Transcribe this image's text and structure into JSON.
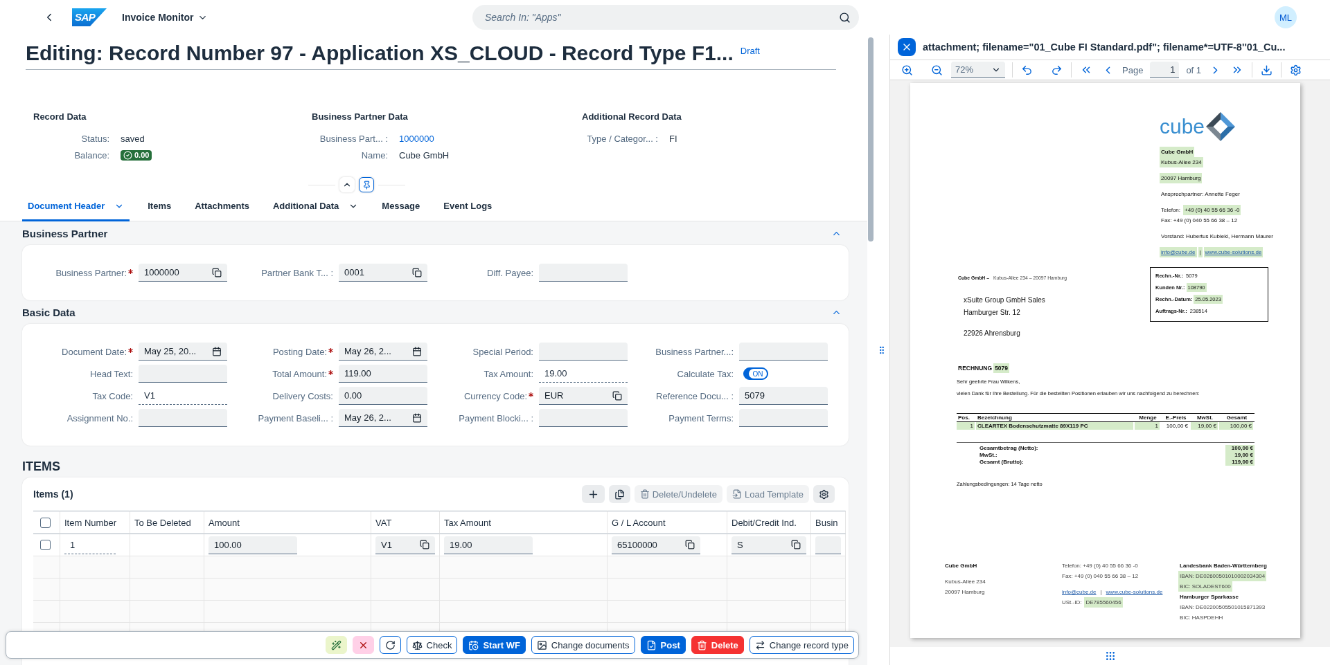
{
  "shell": {
    "logo_text": "SAP",
    "app_title": "Invoice Monitor",
    "search_placeholder": "Search In: \"Apps\"",
    "user_initials": "ML"
  },
  "header": {
    "title": "Editing: Record Number 97 - Application XS_CLOUD - Record Type F1...",
    "status": "Draft",
    "groups": [
      {
        "title": "Record Data",
        "fields": [
          {
            "label": "Status:",
            "value": "saved",
            "kind": "text"
          },
          {
            "label": "Balance:",
            "value": "0.00",
            "kind": "badge"
          }
        ]
      },
      {
        "title": "Business Partner Data",
        "fields": [
          {
            "label": "Business Part... :",
            "value": "1000000",
            "kind": "link"
          },
          {
            "label": "Name:",
            "value": "Cube GmbH",
            "kind": "text"
          }
        ]
      },
      {
        "title": "Additional Record Data",
        "fields": [
          {
            "label": "Type / Categor... :",
            "value": "FI",
            "kind": "text"
          }
        ]
      }
    ]
  },
  "tabs": [
    {
      "label": "Document Header",
      "selected": true,
      "menu": true
    },
    {
      "label": "Items",
      "selected": false,
      "menu": false
    },
    {
      "label": "Attachments",
      "selected": false,
      "menu": false
    },
    {
      "label": "Additional Data",
      "selected": false,
      "menu": true
    },
    {
      "label": "Message",
      "selected": false,
      "menu": false
    },
    {
      "label": "Event Logs",
      "selected": false,
      "menu": false
    }
  ],
  "sections": [
    {
      "title": "Business Partner",
      "expanded": true,
      "fields": [
        {
          "label": "Business Partner:",
          "required": true,
          "kind": "valuehelp",
          "value": "1000000"
        },
        {
          "label": "Partner Bank T... :",
          "required": false,
          "kind": "valuehelp",
          "value": "0001"
        },
        {
          "label": "Diff. Payee:",
          "required": false,
          "kind": "input"
        }
      ]
    },
    {
      "title": "Basic Data",
      "expanded": true,
      "fields": [
        {
          "label": "Document Date:",
          "required": true,
          "kind": "date",
          "value": "May 25, 20..."
        },
        {
          "label": "Posting Date:",
          "required": true,
          "kind": "date",
          "value": "May 26, 2..."
        },
        {
          "label": "Special Period:",
          "required": false,
          "kind": "input"
        },
        {
          "label": "Business Partner...:",
          "required": false,
          "kind": "input"
        },
        {
          "label": "Head Text:",
          "required": false,
          "kind": "input"
        },
        {
          "label": "Total Amount:",
          "required": true,
          "kind": "input",
          "value": "119.00"
        },
        {
          "label": "Tax Amount:",
          "required": false,
          "kind": "text",
          "value": "19.00"
        },
        {
          "label": "Calculate Tax:",
          "required": false,
          "kind": "switch",
          "on": true,
          "value": "ON"
        },
        {
          "label": "Tax Code:",
          "required": false,
          "kind": "text",
          "value": "V1"
        },
        {
          "label": "Delivery Costs:",
          "required": false,
          "kind": "input",
          "value": "0.00"
        },
        {
          "label": "Currency Code:",
          "required": true,
          "kind": "valuehelp",
          "value": "EUR"
        },
        {
          "label": "Reference Docu... :",
          "required": false,
          "kind": "input",
          "value": "5079"
        },
        {
          "label": "Assignment No.:",
          "required": false,
          "kind": "input"
        },
        {
          "label": "Payment Baseli... :",
          "required": false,
          "kind": "date",
          "value": "May 26, 2..."
        },
        {
          "label": "Payment Blocki... :",
          "required": false,
          "kind": "input"
        },
        {
          "label": "Payment Terms:",
          "required": false,
          "kind": "input"
        }
      ]
    }
  ],
  "items": {
    "title": "ITEMS",
    "table_title": "Items (1)",
    "toolbar": [
      {
        "kind": "add",
        "disabled": false
      },
      {
        "kind": "copy",
        "disabled": false
      },
      {
        "kind": "delete",
        "label": "Delete/Undelete",
        "disabled": true
      },
      {
        "kind": "template",
        "label": "Load Template",
        "disabled": true
      },
      {
        "kind": "settings",
        "disabled": false
      }
    ],
    "select_all_checked": false,
    "columns": [
      "Item Number",
      "To Be Deleted",
      "Amount",
      "VAT",
      "Tax Amount",
      "G / L Account",
      "Debit/Credit Ind.",
      "Busin"
    ],
    "rows": [
      {
        "checked": false,
        "cells": [
          {
            "kind": "text",
            "value": "1"
          },
          {
            "kind": "empty"
          },
          {
            "kind": "input",
            "value": "100.00"
          },
          {
            "kind": "valuehelp",
            "value": "V1"
          },
          {
            "kind": "input",
            "value": "19.00"
          },
          {
            "kind": "valuehelp",
            "value": "65100000"
          },
          {
            "kind": "valuehelp",
            "value": "S"
          },
          {
            "kind": "input"
          }
        ]
      }
    ]
  },
  "footer_actions": [
    {
      "kind": "wand"
    },
    {
      "kind": "cancel"
    },
    {
      "kind": "refresh"
    },
    {
      "kind": "check",
      "label": "Check"
    },
    {
      "kind": "workflow",
      "label": "Start WF"
    },
    {
      "kind": "documents",
      "label": "Change documents"
    },
    {
      "kind": "post",
      "label": "Post"
    },
    {
      "kind": "delete",
      "label": "Delete"
    },
    {
      "kind": "change",
      "label": "Change record type"
    }
  ],
  "pdf_viewer": {
    "title": "attachment; filename=\"01_Cube FI Standard.pdf\"; filename*=UTF-8''01_Cu...",
    "zoom": "72%",
    "page_label": "Page",
    "page": "1",
    "page_count": "of 1",
    "document": {
      "logo_text": "cube",
      "sender": [
        {
          "lines": [
            {
              "segments": [
                {
                  "text": "Cube GmbH",
                  "kind": "bold",
                  "highlight": true
                }
              ]
            },
            {
              "segments": [
                {
                  "text": "Kubus-Allee 234",
                  "kind": "normal",
                  "highlight": true
                }
              ]
            }
          ]
        },
        {
          "lines": [
            {
              "segments": [
                {
                  "text": "20097 Hamburg",
                  "kind": "normal",
                  "highlight": true
                }
              ]
            }
          ]
        },
        {
          "lines": [
            {
              "segments": [
                {
                  "text": "Ansprechpartner: Annette Feger",
                  "kind": "normal",
                  "highlight": false
                }
              ]
            }
          ]
        },
        {
          "lines": [
            {
              "segments": [
                {
                  "text": "Telefon:",
                  "kind": "normal",
                  "highlight": false
                },
                {
                  "text": "+49 (0) 40 55 66 36 -0",
                  "kind": "normal",
                  "highlight": true
                }
              ]
            },
            {
              "segments": [
                {
                  "text": "Fax: +49 (0) 040 55 66 38 – 12",
                  "kind": "normal",
                  "highlight": false
                }
              ]
            }
          ]
        },
        {
          "lines": [
            {
              "segments": [
                {
                  "text": "Vorstand: Hubertus Kubieki, Hermann Maurer",
                  "kind": "normal",
                  "highlight": false
                }
              ]
            }
          ]
        },
        {
          "lines": [
            {
              "segments": [
                {
                  "text": "info@cube.de",
                  "kind": "link",
                  "highlight": true
                },
                {
                  "text": "|",
                  "kind": "normal",
                  "highlight": true
                },
                {
                  "text": "www.cube-solutions.de",
                  "kind": "link",
                  "highlight": true
                }
              ]
            }
          ]
        }
      ],
      "sender_line": [
        {
          "text": "Cube GmbH –",
          "kind": "bold",
          "highlight": false
        },
        {
          "text": "Kubus-Allee 234 – 20097 Hamburg",
          "kind": "muted",
          "highlight": false
        }
      ],
      "recipient": [
        "xSuite Group GmbH Sales",
        "Hamburger Str. 12",
        "22926 Ahrensburg"
      ],
      "info_box": [
        {
          "label": "Rechn.-Nr.:",
          "value": "5079",
          "highlight": false
        },
        {
          "label": "Kunden Nr.:",
          "value": "108790",
          "highlight": true
        },
        {
          "label": "Rechn.-Datum:",
          "value": "25.05.2023",
          "highlight": true
        },
        {
          "label": "Auftrags-Nr.:",
          "value": "238514",
          "highlight": false
        }
      ],
      "heading": [
        {
          "text": "RECHNUNG",
          "kind": "bold",
          "highlight": false
        },
        {
          "text": "5079",
          "kind": "bold",
          "highlight": true
        }
      ],
      "salutation": "Sehr geehrte Frau Wilkens,",
      "intro": "vielen Dank für Ihre Bestellung. Für die bestellten Positionen erlauben wir uns nachfolgend zu berechnen:",
      "table_columns": [
        "Pos.",
        "Bezeichnung",
        "Menge",
        "E.-Preis",
        "MwSt.",
        "Gesamt"
      ],
      "table_rows": [
        {
          "cells": [
            {
              "text": "1",
              "highlight": true
            },
            {
              "text": "CLEARTEX Bodenschutzmatte 89X119 PC",
              "highlight": true
            },
            {
              "text": "1",
              "highlight": true
            },
            {
              "text": "100,00 €",
              "highlight": false
            },
            {
              "text": "19,00 €",
              "highlight": true
            },
            {
              "text": "100,00 €",
              "highlight": true
            }
          ]
        }
      ],
      "totals": [
        {
          "label": "Gesamtbetrag (Netto):",
          "value": "100,00 €",
          "highlight": true
        },
        {
          "label": "MwSt.:",
          "value": "19,00 €",
          "highlight": true
        },
        {
          "label": "Gesamt (Brutto):",
          "value": "119,00 €",
          "highlight": true
        }
      ],
      "payment_terms": "Zahlungsbedingungen: 14 Tage netto",
      "footer": [
        [
          {
            "lines": [
              {
                "segments": [
                  {
                    "text": "Cube GmbH",
                    "kind": "bold",
                    "highlight": false
                  }
                ]
              }
            ]
          },
          {
            "lines": [
              {
                "segments": [
                  {
                    "text": "Kubus-Allee 234",
                    "kind": "muted",
                    "highlight": false
                  }
                ]
              },
              {
                "segments": [
                  {
                    "text": "20097 Hamburg",
                    "kind": "muted",
                    "highlight": false
                  }
                ]
              }
            ]
          }
        ],
        [
          {
            "lines": [
              {
                "segments": [
                  {
                    "text": "Telefon: +49 (0) 40 55 66 36 -0",
                    "kind": "muted",
                    "highlight": false
                  }
                ]
              },
              {
                "segments": [
                  {
                    "text": "Fax: +49 (0) 040 55 66 38 – 12",
                    "kind": "muted",
                    "highlight": false
                  }
                ]
              }
            ]
          },
          {
            "lines": [
              {
                "segments": [
                  {
                    "text": "info@cube.de",
                    "kind": "link",
                    "highlight": false
                  },
                  {
                    "text": "|",
                    "kind": "muted",
                    "highlight": false
                  },
                  {
                    "text": "www.cube-solutions.de",
                    "kind": "link",
                    "highlight": false
                  }
                ]
              },
              {
                "segments": [
                  {
                    "text": "USt.-ID:",
                    "kind": "muted",
                    "highlight": false
                  },
                  {
                    "text": "DE785560456",
                    "kind": "muted",
                    "highlight": true
                  }
                ]
              }
            ]
          }
        ],
        [
          {
            "lines": [
              {
                "segments": [
                  {
                    "text": "Landesbank Baden-Württemberg",
                    "kind": "bold",
                    "highlight": false
                  }
                ]
              },
              {
                "segments": [
                  {
                    "text": "IBAN: DE02600501010002034304",
                    "kind": "muted",
                    "highlight": true
                  }
                ]
              },
              {
                "segments": [
                  {
                    "text": "BIC: SOLADEST600",
                    "kind": "muted",
                    "highlight": true
                  }
                ]
              },
              {
                "segments": [
                  {
                    "text": "Hamburger Sparkasse",
                    "kind": "bold",
                    "highlight": false
                  }
                ]
              },
              {
                "segments": [
                  {
                    "text": "IBAN: DE02200505501015871393",
                    "kind": "muted",
                    "highlight": false
                  }
                ]
              },
              {
                "segments": [
                  {
                    "text": "BIC: HASPDEHH",
                    "kind": "muted",
                    "highlight": false
                  }
                ]
              }
            ]
          }
        ]
      ]
    }
  }
}
